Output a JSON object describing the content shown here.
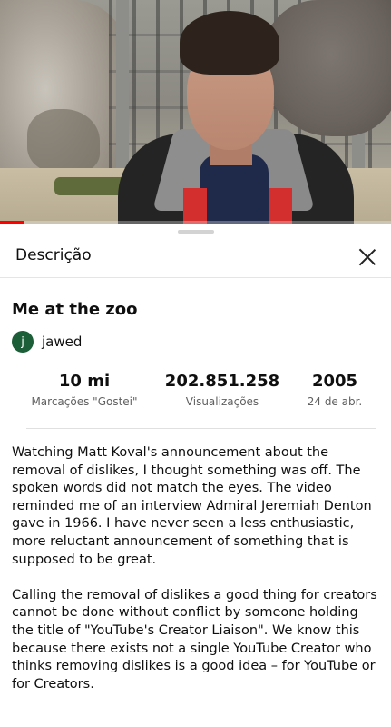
{
  "video": {
    "progress_fraction": 0.06
  },
  "panel": {
    "title": "Descrição",
    "close_icon": "close-icon"
  },
  "video_info": {
    "title": "Me at the zoo",
    "channel_initial": "j",
    "channel_name": "jawed"
  },
  "stats": {
    "likes_value": "10 mi",
    "likes_label": "Marcações \"Gostei\"",
    "views_value": "202.851.258",
    "views_label": "Visualizações",
    "year_value": "2005",
    "date_label": "24 de abr."
  },
  "description": {
    "paragraph_1": "Watching Matt Koval's announcement about the removal of dislikes, I thought something was off. The spoken words did not match the eyes. The video reminded me of an interview Admiral Jeremiah Denton gave in 1966. I have never seen a less enthusiastic, more reluctant announcement of something that is supposed to be great.",
    "paragraph_2": "Calling the removal of dislikes a good thing for creators cannot be done without conflict by someone holding the title of \"YouTube's Creator Liaison\". We know this because there exists not a single YouTube Creator who thinks removing dislikes is a good idea – for YouTube or for Creators."
  },
  "colors": {
    "progress": "#ff0000",
    "avatar": "#1b5e37",
    "secondary_text": "#606060"
  }
}
